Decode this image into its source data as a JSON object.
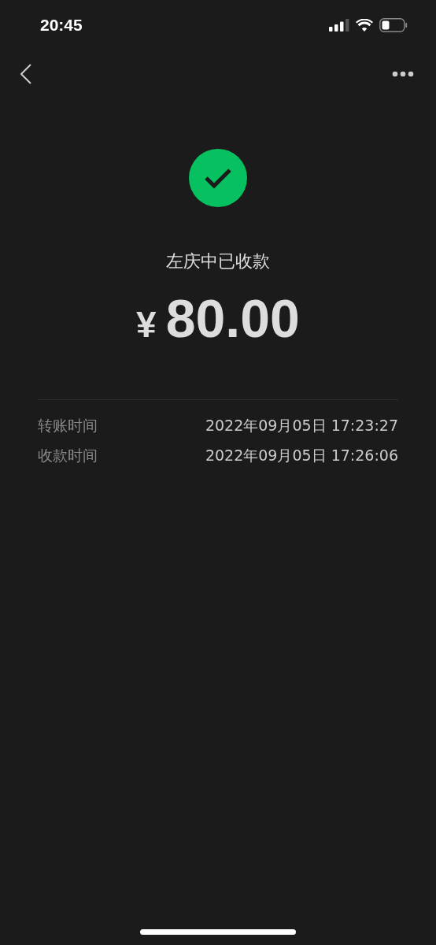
{
  "status_bar": {
    "time": "20:45"
  },
  "result": {
    "received": true,
    "title": "左庆中已收款",
    "currency": "¥",
    "amount": "80.00"
  },
  "details": [
    {
      "label": "转账时间",
      "value": "2022年09月05日 17:23:27"
    },
    {
      "label": "收款时间",
      "value": "2022年09月05日 17:26:06"
    }
  ]
}
